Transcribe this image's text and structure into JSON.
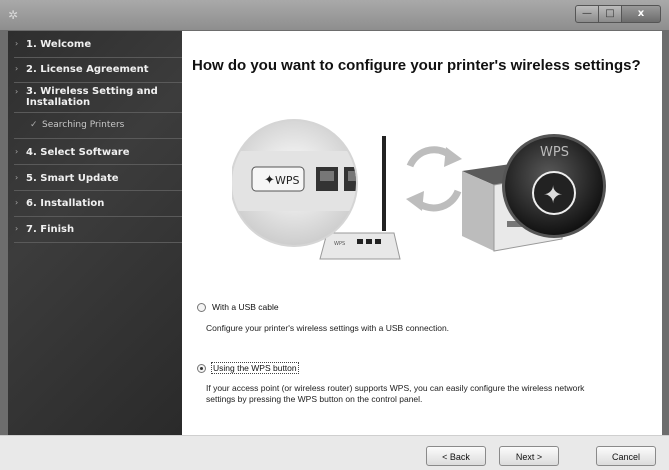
{
  "window": {
    "controls": {
      "minimize": "—",
      "maximize": "□",
      "close": "x"
    }
  },
  "sidebar": {
    "steps": [
      {
        "label": "1. Welcome"
      },
      {
        "label": "2. License Agreement"
      },
      {
        "label": "3. Wireless Setting and Installation"
      },
      {
        "label": "4. Select Software"
      },
      {
        "label": "5. Smart Update"
      },
      {
        "label": "6. Installation"
      },
      {
        "label": "7. Finish"
      }
    ],
    "substep": {
      "label": "Searching Printers",
      "icon": "check-icon"
    }
  },
  "main": {
    "heading": "How do you want to configure your printer's wireless settings?",
    "illustration": {
      "router_badge": "WPS",
      "printer_badge": "WPS",
      "router_port_label": "WPS"
    },
    "options": [
      {
        "label": "With a USB cable",
        "selected": false,
        "description": "Configure your printer's wireless settings with a USB connection."
      },
      {
        "label": "Using the WPS button",
        "selected": true,
        "description_line1": "If your access point (or wireless router) supports WPS, you can easily configure the wireless network",
        "description_line2": "settings by pressing the WPS button on the control panel."
      }
    ]
  },
  "footer": {
    "back_label": "< Back",
    "next_label": "Next >",
    "cancel_label": "Cancel"
  }
}
